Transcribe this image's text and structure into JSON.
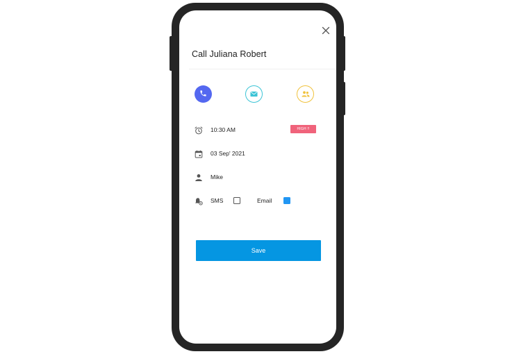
{
  "task": {
    "title": "Call Juliana Robert"
  },
  "actions": {
    "call_icon": "phone-icon",
    "email_icon": "mail-icon",
    "meeting_icon": "people-icon",
    "colors": {
      "call": "#5468f0",
      "email": "#3cc4d6",
      "meeting": "#f0c23c"
    }
  },
  "details": {
    "time": "10:30 AM",
    "priority": "HIGH !!",
    "priority_color": "#f0637b",
    "date": "03 Sep' 2021",
    "assignee": "Mike"
  },
  "notifications": {
    "sms_label": "SMS",
    "sms_checked": false,
    "email_label": "Email",
    "email_checked": true
  },
  "footer": {
    "save_label": "Save",
    "save_color": "#0596e2"
  }
}
